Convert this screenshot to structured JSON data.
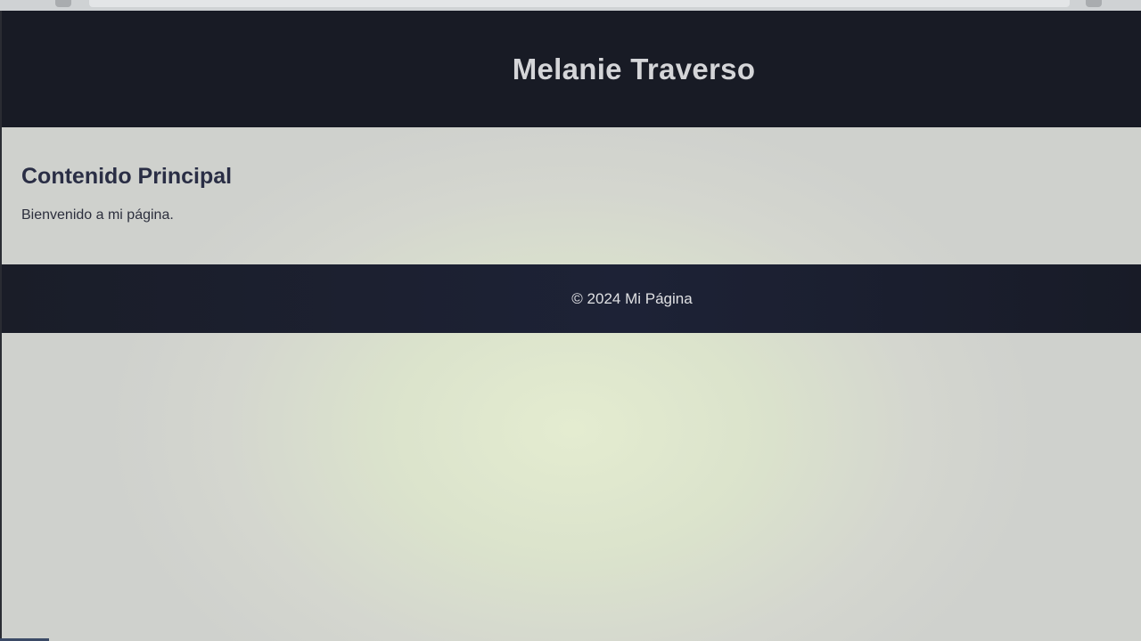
{
  "header": {
    "title": "Melanie Traverso"
  },
  "main": {
    "heading": "Contenido Principal",
    "text": "Bienvenido a mi página."
  },
  "footer": {
    "text": "© 2024 Mi Página"
  },
  "colors": {
    "header_bg": "#181b25",
    "footer_bg": "#1d2236",
    "heading_text": "#2a2e45",
    "page_bg": "#d4d6cf"
  }
}
